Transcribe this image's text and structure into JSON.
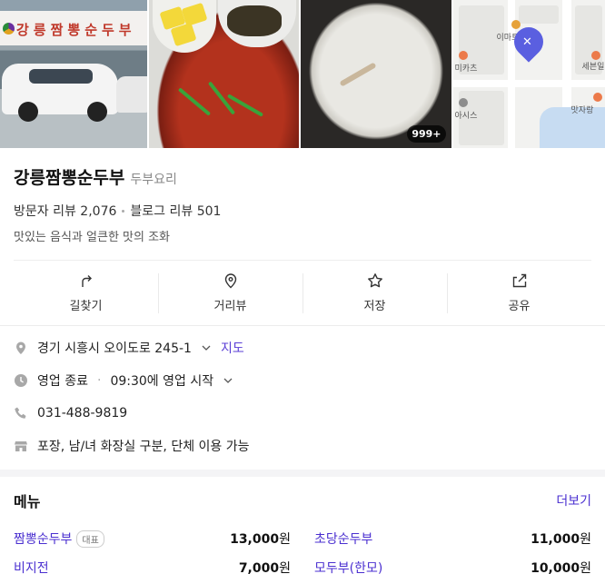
{
  "photos": {
    "sign_text": "강릉짬뽕순두부",
    "more_count": "999+",
    "map_labels": [
      "이마트",
      "미카츠",
      "세븐일",
      "아시스",
      "맛자랑"
    ]
  },
  "place": {
    "name": "강릉짬뽕순두부",
    "category": "두부요리",
    "visitor_reviews": "방문자 리뷰 2,076",
    "blog_reviews": "블로그 리뷰 501",
    "description": "맛있는 음식과 얼큰한 맛의 조화"
  },
  "actions": [
    {
      "label": "길찾기",
      "icon": "directions-icon"
    },
    {
      "label": "거리뷰",
      "icon": "location-pin-icon"
    },
    {
      "label": "저장",
      "icon": "star-icon"
    },
    {
      "label": "공유",
      "icon": "share-icon"
    }
  ],
  "details": {
    "address": "경기 시흥시 오이도로 245-1",
    "map_link": "지도",
    "hours_status": "영업 종료",
    "hours_next": "09:30에 영업 시작",
    "phone": "031-488-9819",
    "amenities": "포장, 남/녀 화장실 구분, 단체 이용 가능"
  },
  "menu": {
    "title": "메뉴",
    "more": "더보기",
    "items": [
      {
        "name": "짬뽕순두부",
        "tag": "대표",
        "price": "13,000",
        "unit": "원"
      },
      {
        "name": "초당순두부",
        "tag": "",
        "price": "11,000",
        "unit": "원"
      },
      {
        "name": "비지전",
        "tag": "",
        "price": "7,000",
        "unit": "원"
      },
      {
        "name": "모두부(한모)",
        "tag": "",
        "price": "10,000",
        "unit": "원"
      }
    ]
  },
  "colors": {
    "accent": "#4a2fd0",
    "pin": "#5a5fe0"
  }
}
